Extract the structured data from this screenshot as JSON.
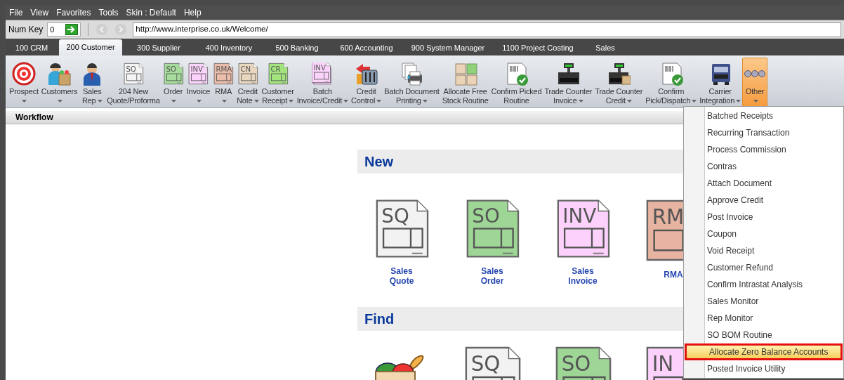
{
  "menu_bar": [
    "File",
    "View",
    "Favorites",
    "Tools",
    "Skin : Default",
    "Help"
  ],
  "address_bar": {
    "num_key_label": "Num Key",
    "num_key_value": "0",
    "url": "http://www.interprise.co.uk/Welcome/"
  },
  "tabs": [
    {
      "label": "100 CRM",
      "selected": false
    },
    {
      "label": "200 Customer",
      "selected": true
    },
    {
      "label": "300 Supplier",
      "selected": false
    },
    {
      "label": "400 Inventory",
      "selected": false
    },
    {
      "label": "500 Banking",
      "selected": false
    },
    {
      "label": "600 Accounting",
      "selected": false
    },
    {
      "label": "900 System Manager",
      "selected": false
    },
    {
      "label": "1100 Project Costing",
      "selected": false
    },
    {
      "label": "Sales",
      "selected": false
    }
  ],
  "ribbon": [
    {
      "kind": "target",
      "lines": [
        "Prospect"
      ],
      "dropdown": true,
      "selected": false
    },
    {
      "kind": "person-bag",
      "lines": [
        "Customers"
      ],
      "dropdown": true,
      "selected": false
    },
    {
      "kind": "person",
      "lines": [
        "Sales",
        "Rep"
      ],
      "dropdown": true,
      "selected": false
    },
    {
      "kind": "doc",
      "code": "SQ",
      "color": "#f4f4f4",
      "lines": [
        "204 New",
        "Quote/Proforma"
      ],
      "dropdown": false,
      "selected": false
    },
    {
      "kind": "doc",
      "code": "SO",
      "color": "#a6dc9c",
      "lines": [
        "Order"
      ],
      "dropdown": true,
      "selected": false
    },
    {
      "kind": "doc",
      "code": "INV",
      "color": "#fbd3fb",
      "lines": [
        "Invoice"
      ],
      "dropdown": true,
      "selected": false
    },
    {
      "kind": "doc",
      "code": "RMA",
      "color": "#ebbcaa",
      "lines": [
        "RMA"
      ],
      "dropdown": true,
      "selected": false
    },
    {
      "kind": "doc",
      "code": "CN",
      "color": "#e8d6bf",
      "lines": [
        "Credit",
        "Note"
      ],
      "dropdown": true,
      "selected": false
    },
    {
      "kind": "doc",
      "code": "CR",
      "color": "#a4e47f",
      "lines": [
        "Customer",
        "Receipt"
      ],
      "dropdown": true,
      "selected": false
    },
    {
      "kind": "doc-stack",
      "code": "INV",
      "color": "#fbd3fb",
      "lines": [
        "Batch",
        "Invoice/Credit"
      ],
      "dropdown": true,
      "selected": false
    },
    {
      "kind": "control",
      "lines": [
        "Credit",
        "Control"
      ],
      "dropdown": true,
      "selected": false
    },
    {
      "kind": "printer",
      "lines": [
        "Batch Document",
        "Printing"
      ],
      "dropdown": true,
      "selected": false
    },
    {
      "kind": "grid",
      "lines": [
        "Allocate Free",
        "Stock Routine"
      ],
      "dropdown": false,
      "selected": false
    },
    {
      "kind": "barcode-check",
      "lines": [
        "Confirm Picked",
        "Routine"
      ],
      "dropdown": false,
      "selected": false
    },
    {
      "kind": "register",
      "lines": [
        "Trade Counter",
        "Invoice"
      ],
      "dropdown": true,
      "selected": false
    },
    {
      "kind": "register-box",
      "lines": [
        "Trade Counter",
        "Credit"
      ],
      "dropdown": true,
      "selected": false
    },
    {
      "kind": "barcode-check",
      "lines": [
        "Confirm",
        "Pick/Dispatch"
      ],
      "dropdown": true,
      "selected": false
    },
    {
      "kind": "truck",
      "lines": [
        "Carrier",
        "Integration"
      ],
      "dropdown": true,
      "selected": false
    },
    {
      "kind": "dots",
      "lines": [
        "Other"
      ],
      "dropdown": true,
      "selected": true
    }
  ],
  "workflow": {
    "title": "Workflow",
    "sections": [
      {
        "title": "New",
        "tiles": [
          {
            "kind": "doc",
            "code": "SQ",
            "color": "#f2f2f2",
            "lines": [
              "Sales",
              "Quote"
            ]
          },
          {
            "kind": "doc",
            "code": "SO",
            "color": "#9ed696",
            "lines": [
              "Sales",
              "Order"
            ]
          },
          {
            "kind": "doc",
            "code": "INV",
            "color": "#fcd2fc",
            "lines": [
              "Sales",
              "Invoice"
            ]
          },
          {
            "kind": "doc",
            "code": "RM",
            "color": "#e8b4a2",
            "lines": [
              "RMA"
            ]
          }
        ]
      },
      {
        "title": "Find",
        "tiles": [
          {
            "kind": "basket"
          },
          {
            "kind": "doc",
            "code": "SQ",
            "color": "#f2f2f2"
          },
          {
            "kind": "doc",
            "code": "SO",
            "color": "#9ed696"
          },
          {
            "kind": "doc",
            "code": "IN",
            "color": "#fcd2fc"
          }
        ]
      }
    ]
  },
  "other_menu": [
    {
      "label": "Batched Receipts",
      "selected": false
    },
    {
      "label": "Recurring Transaction",
      "selected": false
    },
    {
      "label": "Process Commission",
      "selected": false
    },
    {
      "label": "Contras",
      "selected": false
    },
    {
      "label": "Attach Document",
      "selected": false
    },
    {
      "label": "Approve Credit",
      "selected": false
    },
    {
      "label": "Post Invoice",
      "selected": false
    },
    {
      "label": "Coupon",
      "selected": false
    },
    {
      "label": "Void Receipt",
      "selected": false
    },
    {
      "label": "Customer Refund",
      "selected": false
    },
    {
      "label": "Confirm Intrastat Analysis",
      "selected": false
    },
    {
      "label": "Sales Monitor",
      "selected": false
    },
    {
      "label": "Rep Monitor",
      "selected": false
    },
    {
      "label": "SO BOM Routine",
      "selected": false
    },
    {
      "label": "Allocate Zero Balance Accounts",
      "selected": true
    },
    {
      "label": "Posted Invoice Utility",
      "selected": false
    }
  ]
}
